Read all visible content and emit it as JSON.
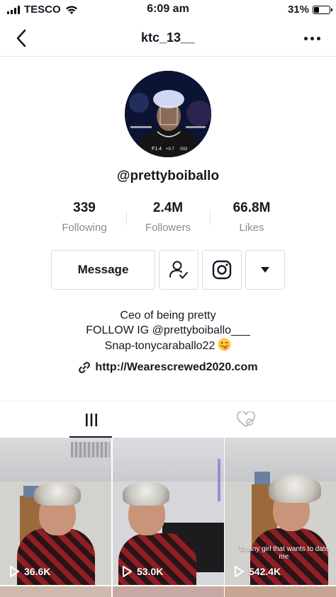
{
  "status_bar": {
    "carrier": "TESCO",
    "time": "6:09 am",
    "battery_percent": "31%",
    "battery_level": 0.31
  },
  "nav": {
    "title": "ktc_13__",
    "back_icon": "chevron-left-icon",
    "more_icon": "more-dots-icon"
  },
  "profile": {
    "handle": "@prettyboiballo",
    "stats": [
      {
        "value": "339",
        "label": "Following"
      },
      {
        "value": "2.4M",
        "label": "Followers"
      },
      {
        "value": "66.8M",
        "label": "Likes"
      }
    ],
    "buttons": {
      "message": "Message",
      "following_icon": "user-check-icon",
      "instagram_icon": "instagram-icon",
      "more_icon": "caret-down-icon"
    },
    "bio_lines": [
      "Ceo of being pretty",
      "FOLLOW IG @prettyboiballo___",
      "Snap-tonycaraballo22"
    ],
    "bio_emoji": "tongue-wink-emoji",
    "link": "http://Wearescrewed2020.com"
  },
  "tabs": [
    {
      "name": "videos",
      "icon": "grid-bars-icon",
      "active": true
    },
    {
      "name": "liked",
      "icon": "heart-hidden-icon",
      "active": false
    }
  ],
  "videos": [
    {
      "views": "36.6K",
      "caption": ""
    },
    {
      "views": "53.0K",
      "caption": ""
    },
    {
      "views": "542.4K",
      "caption": "To any girl that wants to date me"
    }
  ],
  "colors": {
    "text": "#161823",
    "muted": "#8a8b91",
    "border": "#dcdce0"
  }
}
